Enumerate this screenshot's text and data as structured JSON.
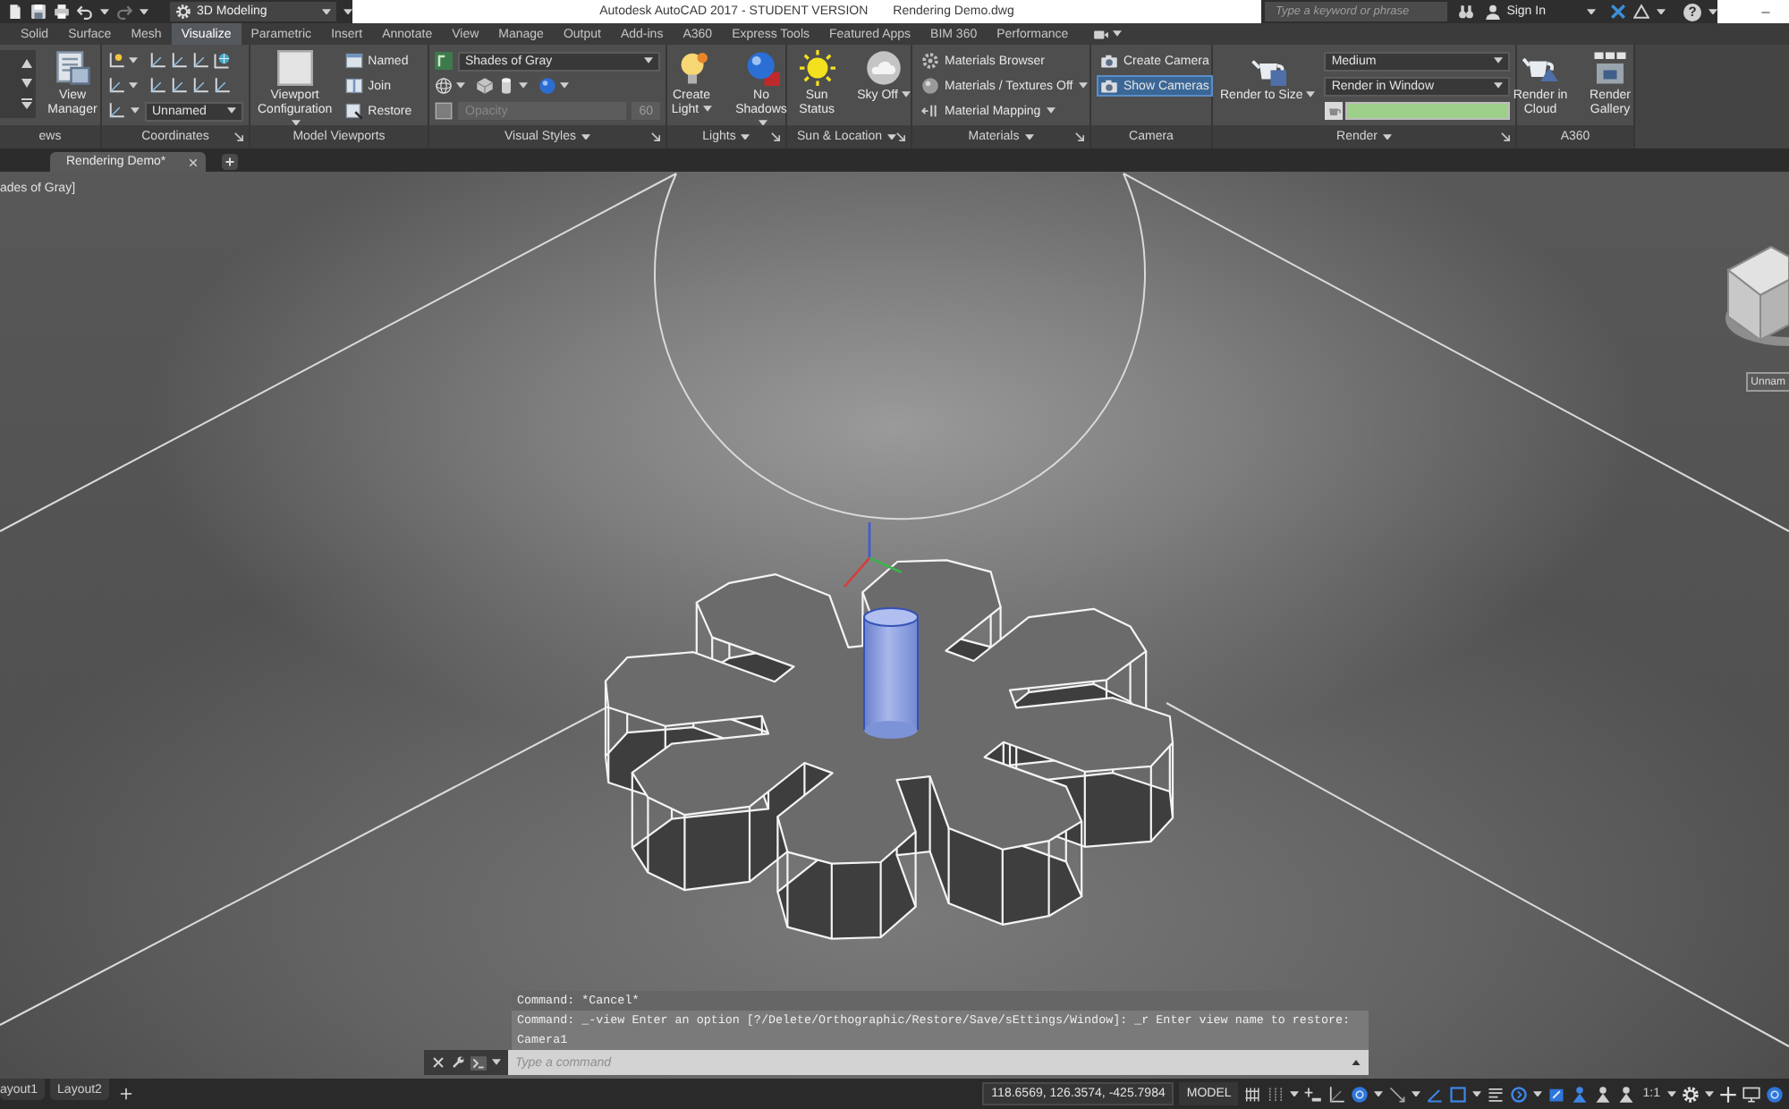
{
  "title_bar": {
    "workspace": "3D Modeling",
    "app_title": "Autodesk AutoCAD 2017 - STUDENT VERSION",
    "file_name": "Rendering Demo.dwg",
    "search": {
      "placeholder": "Type a keyword or phrase"
    },
    "sign_in": "Sign In",
    "help": "?"
  },
  "ribbon": {
    "tabs": [
      {
        "label": "Solid",
        "selected": false
      },
      {
        "label": "Surface",
        "selected": false
      },
      {
        "label": "Mesh",
        "selected": false
      },
      {
        "label": "Visualize",
        "selected": true
      },
      {
        "label": "Parametric",
        "selected": false
      },
      {
        "label": "Insert",
        "selected": false
      },
      {
        "label": "Annotate",
        "selected": false
      },
      {
        "label": "View",
        "selected": false
      },
      {
        "label": "Manage",
        "selected": false
      },
      {
        "label": "Output",
        "selected": false
      },
      {
        "label": "Add-ins",
        "selected": false
      },
      {
        "label": "A360",
        "selected": false
      },
      {
        "label": "Express Tools",
        "selected": false
      },
      {
        "label": "Featured Apps",
        "selected": false
      },
      {
        "label": "BIM 360",
        "selected": false
      },
      {
        "label": "Performance",
        "selected": false
      }
    ],
    "panels": [
      {
        "title": "ews",
        "title_menu": false,
        "launcher": false,
        "columns": [
          {
            "kind": "gallery"
          },
          {
            "kind": "large",
            "label": "View Manager",
            "menu": false
          }
        ]
      },
      {
        "title": "Coordinates",
        "title_menu": false,
        "launcher": true,
        "columns": [
          {
            "kind": "stack",
            "items": [
              {
                "kind": "tools"
              },
              {
                "kind": "tools"
              },
              {
                "kind": "dropdown",
                "value": "Unnamed"
              }
            ]
          }
        ]
      },
      {
        "title": "Model Viewports",
        "title_menu": false,
        "launcher": false,
        "columns": [
          {
            "kind": "large",
            "label": "Viewport Configuration",
            "menu": true
          },
          {
            "kind": "stack",
            "items": [
              {
                "kind": "small",
                "label": "Named",
                "menu": false,
                "selected": false
              },
              {
                "kind": "small",
                "label": "Join",
                "menu": false,
                "selected": false
              },
              {
                "kind": "small",
                "label": "Restore",
                "menu": false,
                "selected": false
              }
            ]
          }
        ]
      },
      {
        "title": "Visual Styles",
        "title_menu": true,
        "launcher": true,
        "columns": [
          {
            "kind": "stack",
            "items": [
              {
                "kind": "dropdown",
                "value": "Shades of Gray"
              },
              {
                "kind": "tools"
              },
              {
                "kind": "slider",
                "placeholder": "Opacity",
                "value": "60",
                "disabled": true
              }
            ]
          }
        ]
      },
      {
        "title": "Lights",
        "title_menu": true,
        "launcher": true,
        "columns": [
          {
            "kind": "large",
            "label": "Create Light",
            "menu": true
          },
          {
            "kind": "large",
            "label": "No Shadows",
            "menu": true
          }
        ]
      },
      {
        "title": "Sun & Location",
        "title_menu": true,
        "launcher": true,
        "columns": [
          {
            "kind": "large",
            "label": "Sun Status",
            "menu": false
          },
          {
            "kind": "large",
            "label": "Sky Off",
            "menu": true
          }
        ]
      },
      {
        "title": "Materials",
        "title_menu": true,
        "launcher": true,
        "columns": [
          {
            "kind": "stack",
            "items": [
              {
                "kind": "small",
                "label": "Materials Browser",
                "menu": false,
                "selected": false
              },
              {
                "kind": "small",
                "label": "Materials / Textures Off",
                "menu": true,
                "selected": false
              },
              {
                "kind": "small",
                "label": "Material Mapping",
                "menu": true,
                "selected": false
              }
            ]
          }
        ]
      },
      {
        "title": "Camera",
        "title_menu": false,
        "launcher": false,
        "columns": [
          {
            "kind": "stack",
            "items": [
              {
                "kind": "small",
                "label": "Create Camera",
                "menu": false,
                "selected": false
              },
              {
                "kind": "small",
                "label": "Show Cameras",
                "menu": false,
                "selected": true
              }
            ]
          }
        ]
      },
      {
        "title": "Render",
        "title_menu": true,
        "launcher": true,
        "columns": [
          {
            "kind": "large",
            "label": "Render to Size",
            "menu": true
          },
          {
            "kind": "stack",
            "items": [
              {
                "kind": "dropdown",
                "value": "Medium"
              },
              {
                "kind": "dropdown",
                "value": "Render in Window"
              },
              {
                "kind": "progress",
                "level": 1
              }
            ]
          }
        ]
      },
      {
        "title": "A360",
        "title_menu": false,
        "launcher": false,
        "columns": [
          {
            "kind": "large",
            "label": "Render in Cloud",
            "menu": false
          },
          {
            "kind": "large",
            "label": "Render Gallery",
            "menu": false
          }
        ]
      }
    ]
  },
  "file_tabs": [
    {
      "label": "Rendering Demo*",
      "selected": true
    }
  ],
  "viewport": {
    "style_label": "ades of Gray]",
    "ucs_menu": "Unnam"
  },
  "command_line": {
    "history": [
      "Command: *Cancel*",
      "Command: _-view Enter an option [?/Delete/Orthographic/Restore/Save/sEttings/Window]: _r Enter view name to restore:",
      "Camera1"
    ],
    "input": {
      "placeholder": "Type a command"
    }
  },
  "status_bar": {
    "layout_tabs": [
      {
        "label": "ayout1",
        "selected": false
      },
      {
        "label": "Layout2",
        "selected": false
      }
    ],
    "coordinates": "118.6569, 126.3574, -425.7984",
    "space": "MODEL",
    "scale": "1:1"
  }
}
